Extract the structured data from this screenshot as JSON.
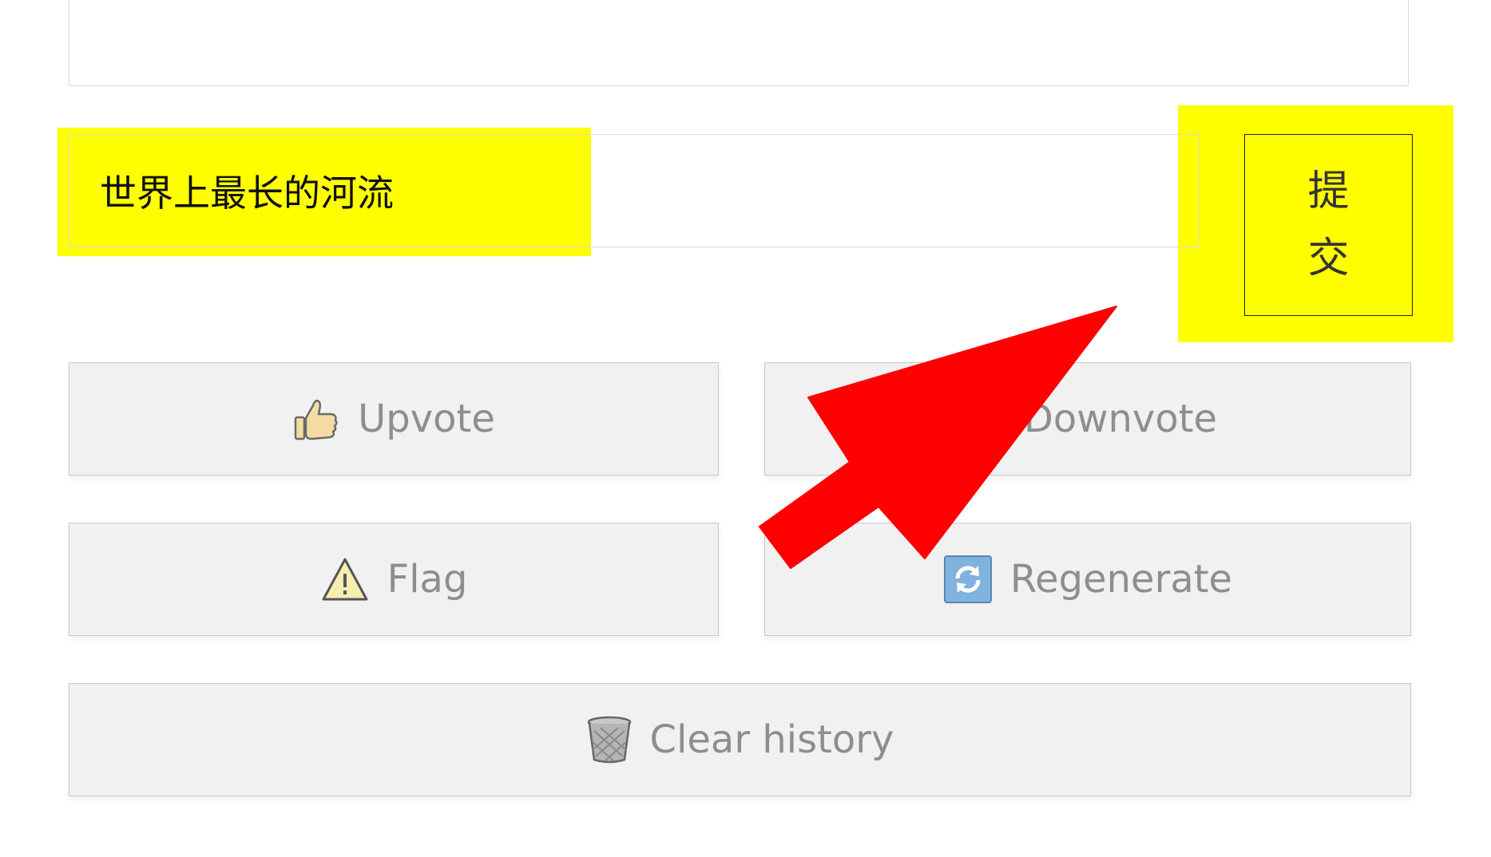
{
  "input": {
    "value": "世界上最长的河流"
  },
  "submit": {
    "label": "提交"
  },
  "actions": {
    "upvote_label": "Upvote",
    "downvote_label": "Downvote",
    "flag_label": "Flag",
    "regenerate_label": "Regenerate",
    "clear_label": "Clear history"
  },
  "icons": {
    "upvote": "thumbs-up-icon",
    "downvote": "thumbs-down-icon",
    "flag": "warning-icon",
    "regenerate": "refresh-icon",
    "clear": "trash-icon"
  },
  "colors": {
    "highlight": "#ffff00",
    "arrow": "#ff0000",
    "button_bg": "#f1f1f1",
    "button_text": "#8e8e8e"
  }
}
